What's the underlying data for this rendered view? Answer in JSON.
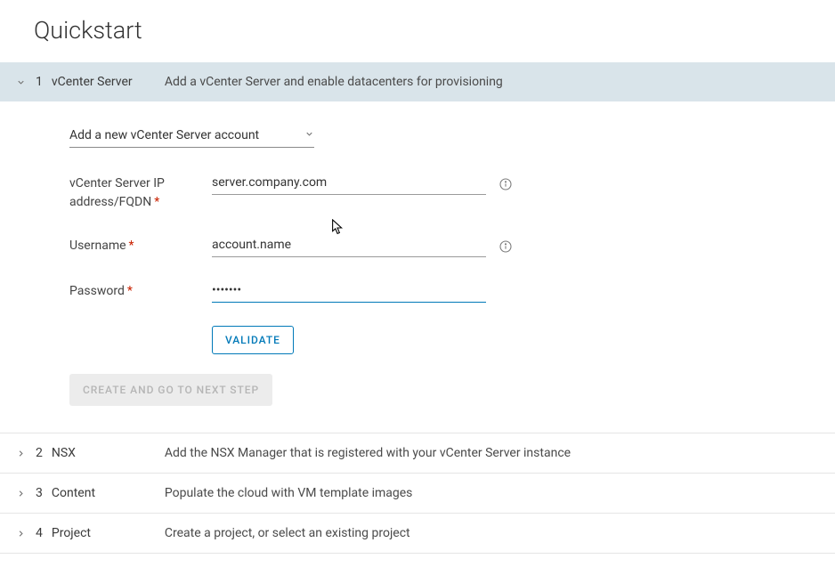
{
  "page": {
    "title": "Quickstart"
  },
  "steps": [
    {
      "number": "1",
      "title": "vCenter Server",
      "subtitle": "Add a vCenter Server and enable datacenters for provisioning",
      "expanded": true
    },
    {
      "number": "2",
      "title": "NSX",
      "subtitle": "Add the NSX Manager that is registered with your vCenter Server instance",
      "expanded": false
    },
    {
      "number": "3",
      "title": "Content",
      "subtitle": "Populate the cloud with VM template images",
      "expanded": false
    },
    {
      "number": "4",
      "title": "Project",
      "subtitle": "Create a project, or select an existing project",
      "expanded": false
    }
  ],
  "form": {
    "dropdown": {
      "selected": "Add a new vCenter Server account"
    },
    "fields": {
      "server": {
        "label": "vCenter Server IP address/FQDN",
        "value": "server.company.com"
      },
      "username": {
        "label": "Username",
        "value": "account.name"
      },
      "password": {
        "label": "Password",
        "value": "•••••••"
      }
    },
    "buttons": {
      "validate": "Validate",
      "create": "Create and Go to Next Step"
    }
  }
}
